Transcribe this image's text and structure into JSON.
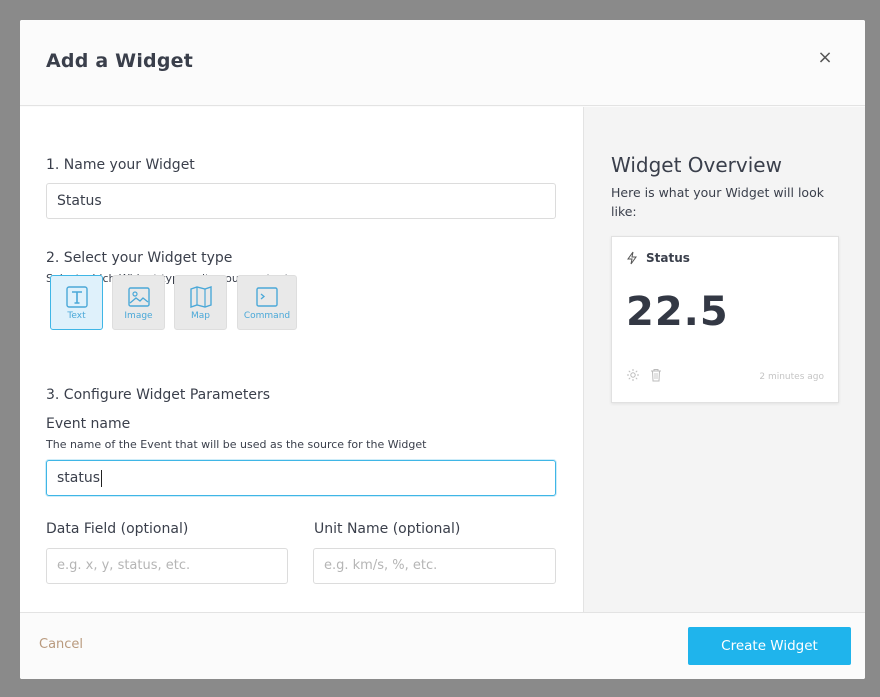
{
  "modal": {
    "title": "Add a Widget",
    "close_label": "×"
  },
  "form": {
    "step1": {
      "label": "1. Name your Widget",
      "value": "Status"
    },
    "step2": {
      "label": "2. Select your Widget type",
      "help": "Select which Widget type suits your content",
      "types": [
        {
          "label": "Text",
          "icon": "text-icon",
          "selected": true
        },
        {
          "label": "Image",
          "icon": "image-icon",
          "selected": false
        },
        {
          "label": "Map",
          "icon": "map-icon",
          "selected": false
        },
        {
          "label": "Command",
          "icon": "terminal-icon",
          "selected": false
        }
      ]
    },
    "step3": {
      "label": "3. Configure Widget Parameters",
      "event_name_label": "Event name",
      "event_name_help": "The name of the Event that will be used as the source for the Widget",
      "event_name_value": "status",
      "data_field_label": "Data Field (optional)",
      "data_field_placeholder": "e.g. x, y, status, etc.",
      "unit_name_label": "Unit Name (optional)",
      "unit_name_placeholder": "e.g. km/s, %, etc."
    }
  },
  "overview": {
    "title": "Widget Overview",
    "subtitle": "Here is what your Widget will look like:",
    "card": {
      "title": "Status",
      "value": "22.5",
      "timestamp": "2 minutes ago"
    }
  },
  "footer": {
    "cancel_label": "Cancel",
    "create_label": "Create Widget"
  },
  "colors": {
    "accent": "#1fb4ec",
    "focus_border": "#3fb6e6",
    "cancel_text": "#b99a7e",
    "overlay": "#8a8a8a"
  }
}
